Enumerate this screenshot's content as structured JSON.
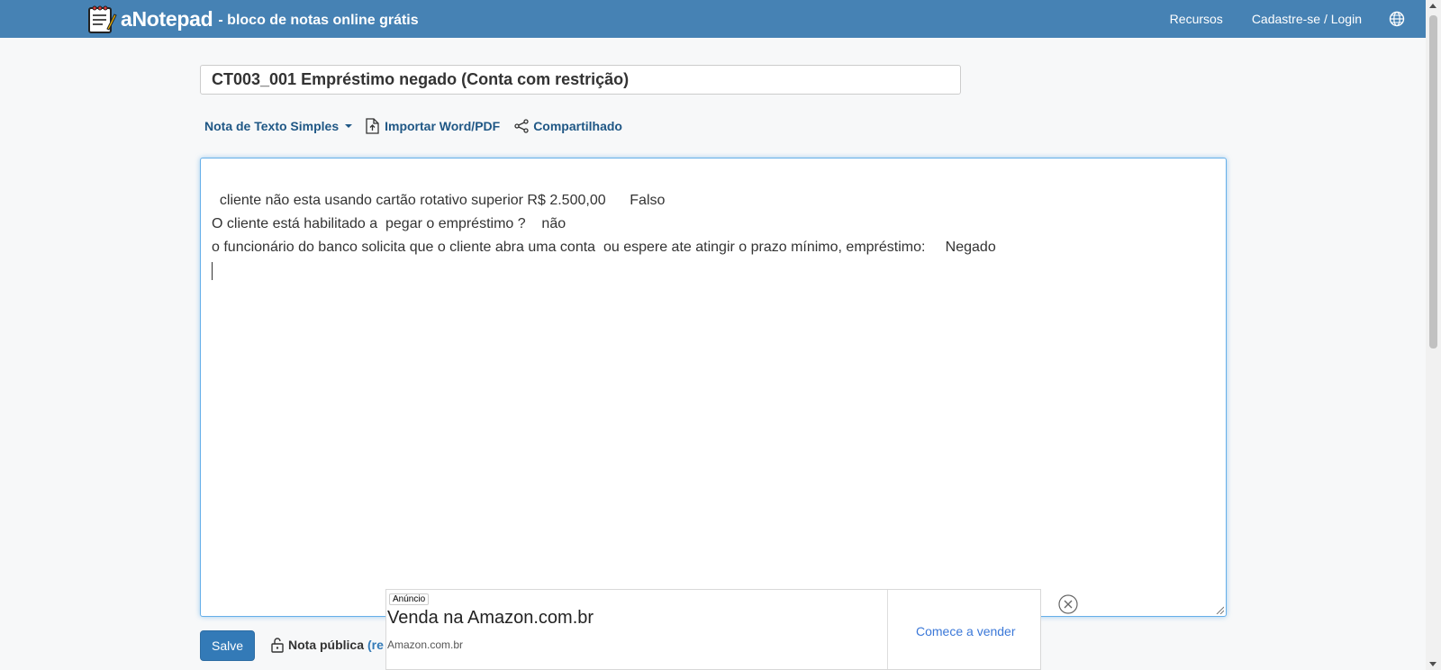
{
  "header": {
    "brand_name": "aNotepad",
    "tagline": "- bloco de notas online grátis",
    "nav_resources": "Recursos",
    "nav_login": "Cadastre-se / Login",
    "language_icon": "globe-icon"
  },
  "note": {
    "title": "CT003_001 Empréstimo negado (Conta com restrição)",
    "content": "cliente não esta usando cartão rotativo superior R$ 2.500,00      Falso\nO cliente está habilitado a  pegar o empréstimo ?    não\no funcionário do banco solicita que o cliente abra uma conta  ou espere ate atingir o prazo mínimo, empréstimo:     Negado\n"
  },
  "toolbar": {
    "note_type": "Nota de Texto Simples",
    "import_label": "Importar Word/PDF",
    "share_label": "Compartilhado"
  },
  "footer": {
    "save_label": "Salve",
    "public_note_label": "Nota pública",
    "public_note_link_fragment": "(re"
  },
  "ad": {
    "badge": "Anúncio",
    "headline": "Venda na Amazon.com.br",
    "domain": "Amazon.com.br",
    "cta": "Comece a vender"
  },
  "colors": {
    "navbar": "#4682b4",
    "link": "#1f5785",
    "save_button": "#337ab7",
    "editor_focus": "#66afe9"
  }
}
